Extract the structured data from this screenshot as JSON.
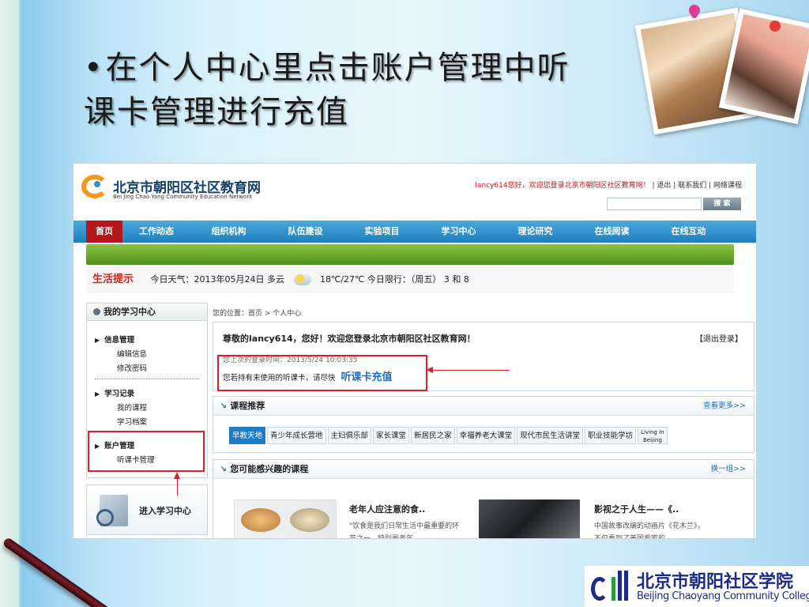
{
  "slide": {
    "bullet": "•",
    "title_line1": "在个人中心里点击账户管理中听",
    "title_line2": "课卡管理进行充值"
  },
  "site": {
    "name": "北京市朝阳区社区教育网",
    "subtitle": "Bei Jing Chao Yang Community Education Network",
    "greeting": "lancy614您好，欢迎您登录北京市朝阳区社区教育网！",
    "top_links": [
      "退出",
      "联系我们",
      "网络课程"
    ],
    "search_button": "搜 索",
    "search_placeholder": ""
  },
  "nav": [
    "首页",
    "工作动态",
    "组织机构",
    "队伍建设",
    "实验项目",
    "学习中心",
    "理论研究",
    "在线阅读",
    "在线互动"
  ],
  "tip": {
    "label": "生活提示",
    "weather_prefix": "今日天气：2013年05月24日 多云",
    "weather_suffix": "18℃/27℃ 今日限行：（周五） 3 和 8"
  },
  "sidebar": {
    "title": "我的学习中心",
    "groups": [
      {
        "title": "信息管理",
        "items": [
          "编辑信息",
          "修改密码"
        ]
      },
      {
        "title": "学习记录",
        "items": [
          "我的课程",
          "学习档案"
        ]
      },
      {
        "title": "账户管理",
        "items": [
          "听课卡管理"
        ]
      }
    ],
    "enter_label": "进入学习中心"
  },
  "breadcrumb": "您的位置：首页 > 个人中心",
  "welcome": {
    "line": "尊敬的lancy614，您好！欢迎您登录北京市朝阳区社区教育网！",
    "logout": "【退出登录】",
    "last_login": "您上次的登录时间：2013/5/24 10:03:35",
    "card_notice": "您若持有未使用的听课卡，请尽快",
    "recharge": "听课卡充值"
  },
  "course_recommend": {
    "title": "课程推荐",
    "more": "查看更多>>",
    "tabs": [
      "早教天地",
      "青少年成长营地",
      "主妇俱乐部",
      "家长课堂",
      "新居民之家",
      "幸福养老大课堂",
      "现代市民生活讲堂",
      "职业技能学坊"
    ],
    "tab_small_1": "Living In",
    "tab_small_2": "Beijing"
  },
  "interest": {
    "title": "您可能感兴趣的课程",
    "more": "换一组>>",
    "item1_title": "老年人应注意的食..",
    "item1_desc": "\"饮食是我们日常生活中最重要的环节之一，特别是老年",
    "item2_title": "影视之于人生——《..",
    "item2_desc": "中国故事改编的动画片《花木兰》，不仅看到了美国爱家的"
  },
  "college": {
    "name_cn": "北京市朝阳社区学院",
    "name_en": "Beijing Chaoyang Community College"
  }
}
